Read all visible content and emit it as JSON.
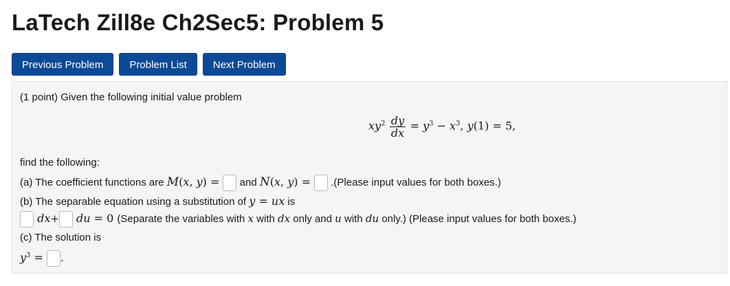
{
  "page_title": "LaTech Zill8e Ch2Sec5: Problem 5",
  "nav": {
    "prev": "Previous Problem",
    "list": "Problem List",
    "next": "Next Problem"
  },
  "problem": {
    "intro": "(1 point) Given the following initial value problem",
    "find": "find the following:",
    "part_a_start": "(a) The coefficient functions are",
    "part_a_and": "and",
    "part_a_note": ".(Please input values for both boxes.)",
    "part_b": "(b) The separable equation using a substitution of",
    "part_b_end": "is",
    "part_b_note_1": "(Separate the variables with",
    "part_b_note_2": "with",
    "part_b_note_3": "only and",
    "part_b_note_4": "with",
    "part_b_note_5": "only.) (Please input values for both boxes.)",
    "part_c": "(c) The solution is"
  },
  "colors": {
    "button_bg": "#0b4a96",
    "panel_bg": "#f5f5f5"
  }
}
